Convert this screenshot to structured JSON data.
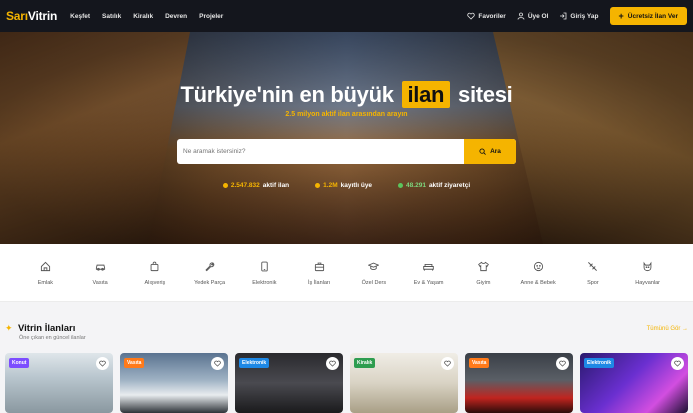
{
  "brand": {
    "part1": "Sarı",
    "part2": "Vitrin"
  },
  "nav": {
    "links": [
      "Keşfet",
      "Satılık",
      "Kiralık",
      "Devren",
      "Projeler"
    ]
  },
  "account": {
    "favorites": "Favoriler",
    "register": "Üye Ol",
    "login": "Giriş Yap",
    "cta": "Ücretsiz İlan Ver"
  },
  "hero": {
    "title_before": "Türkiye'nin en büyük",
    "title_highlight": "ilan",
    "title_after": "sitesi",
    "subtitle": "2.5 milyon aktif ilan arasından arayın",
    "search_placeholder": "Ne aramak istersiniz?",
    "search_button": "Ara",
    "stats": [
      {
        "value": "2.547.832",
        "label": "aktif ilan",
        "color": "#f5b400"
      },
      {
        "value": "1.2M",
        "label": "kayıtlı üye",
        "color": "#f5b400"
      },
      {
        "value": "48.291",
        "label": "aktif ziyaretçi",
        "color": "#5cc45c"
      }
    ]
  },
  "categories": [
    {
      "label": "Emlak",
      "icon": "home-icon"
    },
    {
      "label": "Vasıta",
      "icon": "car-icon"
    },
    {
      "label": "Alışveriş",
      "icon": "bag-icon"
    },
    {
      "label": "Yedek Parça",
      "icon": "wrench-icon"
    },
    {
      "label": "Elektronik",
      "icon": "phone-icon"
    },
    {
      "label": "İş İlanları",
      "icon": "briefcase-icon"
    },
    {
      "label": "Özel Ders",
      "icon": "graduation-icon"
    },
    {
      "label": "Ev & Yaşam",
      "icon": "sofa-icon"
    },
    {
      "label": "Giyim",
      "icon": "shirt-icon"
    },
    {
      "label": "Anne & Bebek",
      "icon": "baby-icon"
    },
    {
      "label": "Spor",
      "icon": "sport-icon"
    },
    {
      "label": "Hayvanlar",
      "icon": "pet-icon"
    }
  ],
  "showcase": {
    "title": "Vitrin İlanları",
    "subtitle": "Öne çıkan en güncel ilanlar",
    "view_all": "Tümünü Gör →",
    "cards": [
      {
        "tag": "Konut",
        "tag_color": "#7c4dff"
      },
      {
        "tag": "Vasıta",
        "tag_color": "#ff7a1a"
      },
      {
        "tag": "Elektronik",
        "tag_color": "#1e88e5"
      },
      {
        "tag": "Kiralık",
        "tag_color": "#2e9d4f"
      },
      {
        "tag": "Vasıta",
        "tag_color": "#ff7a1a"
      },
      {
        "tag": "Elektronik",
        "tag_color": "#1e88e5"
      }
    ]
  }
}
